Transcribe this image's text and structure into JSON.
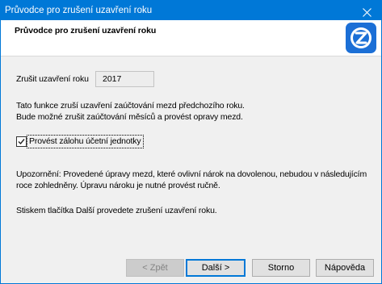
{
  "window": {
    "title": "Průvodce pro zrušení uzavření roku",
    "close_icon": "close-icon"
  },
  "header": {
    "title": "Průvodce pro zrušení uzavření roku",
    "logo_icon": "app-logo-icon"
  },
  "year_field": {
    "label": "Zrušit uzavření roku",
    "value": "2017"
  },
  "info": {
    "line1": "Tato funkce zruší uzavření zaúčtování mezd předchozího roku.",
    "line2": "Bude možné zrušit zaúčtování měsíců a provést opravy mezd."
  },
  "backup_checkbox": {
    "label": "Provést zálohu účetní jednotky",
    "checked": true
  },
  "warning": {
    "line1": "Upozornění: Provedené úpravy mezd, které ovlivní nárok na dovolenou, nebudou v následujícím",
    "line2": "roce zohledněny. Úpravu nároku je nutné provést ručně."
  },
  "instruction": "Stiskem tlačítka Další provedete zrušení uzavření roku.",
  "buttons": {
    "back": {
      "label": "< Zpět",
      "disabled": true
    },
    "next": {
      "label": "Další >",
      "default": true
    },
    "cancel": {
      "label": "Storno"
    },
    "help": {
      "label": "Nápověda"
    }
  },
  "colors": {
    "title_bar": "#0078D7",
    "accent": "#0078D7",
    "body": "#F0F0F0",
    "header": "#FFFFFF"
  }
}
